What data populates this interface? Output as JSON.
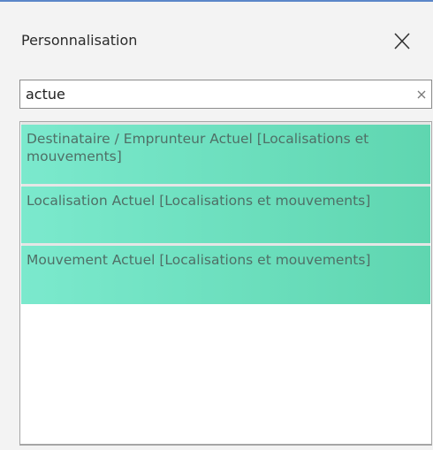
{
  "panel": {
    "title": "Personnalisation"
  },
  "search": {
    "value": "actue",
    "placeholder": ""
  },
  "icons": {
    "close": "close-icon",
    "clear": "clear-icon"
  },
  "results": {
    "items": [
      {
        "label": "Destinataire / Emprunteur Actuel [Localisations et mouvements]"
      },
      {
        "label": "Localisation Actuel [Localisations et mouvements]"
      },
      {
        "label": "Mouvement Actuel [Localisations et mouvements]"
      }
    ]
  },
  "colors": {
    "accent_border": "#5b86c8",
    "highlight_start": "#7be9cd",
    "highlight_end": "#5fd6b0",
    "item_text": "#4f6f66"
  }
}
